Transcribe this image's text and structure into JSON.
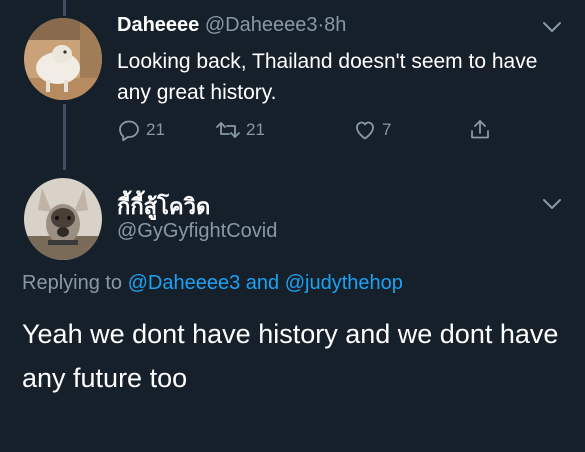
{
  "tweet1": {
    "author_name": "Daheeee",
    "handle": "@Daheeee3",
    "separator": "·",
    "time": "8h",
    "text": "Looking back, Thailand doesn't seem to have any great history.",
    "actions": {
      "replies": "21",
      "retweets": "21",
      "likes": "7"
    }
  },
  "tweet2": {
    "author_name": "กี้กี้สู้โควิด",
    "handle": "@GyGyfightCovid",
    "replying_prefix": "Replying to",
    "replying_to_1": "@Daheeee3",
    "replying_and": "and",
    "replying_to_2": "@judythehop",
    "text": "Yeah we dont have history and we dont have any future too"
  },
  "colors": {
    "background": "#15202b",
    "text_primary": "#ffffff",
    "text_muted": "#8899a6",
    "link": "#1da1f2",
    "thread_line": "#3d4f60"
  },
  "icons": {
    "avatar1": "sheep-avatar",
    "avatar2": "dog-avatar",
    "reply": "reply-icon",
    "retweet": "retweet-icon",
    "like": "heart-icon",
    "share": "share-icon",
    "menu": "chevron-down-icon"
  }
}
